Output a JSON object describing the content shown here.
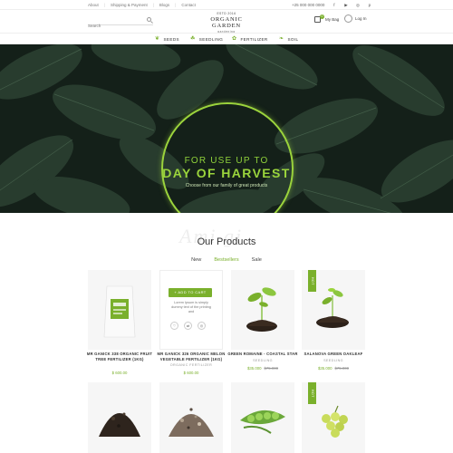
{
  "topbar": {
    "links": [
      "About",
      "Shipping & Payment",
      "Blogs",
      "Contact"
    ],
    "phone": "+25 000 000 0000",
    "social_icons": [
      "facebook-icon",
      "youtube-icon",
      "instagram-icon",
      "pinterest-icon"
    ]
  },
  "header": {
    "search_placeholder": "Search",
    "logo_est": "ESTD 2016",
    "logo_name": "ORGANIC GARDEN",
    "logo_sub": "gardening",
    "cart_count": "0",
    "cart_label": "My Bag",
    "login_label": "Log In"
  },
  "categories": [
    {
      "label": "SEEDS",
      "icon": "seed-icon"
    },
    {
      "label": "SEEDLING",
      "icon": "seedling-icon"
    },
    {
      "label": "FERTILIZER",
      "icon": "fertilizer-icon"
    },
    {
      "label": "SOIL",
      "icon": "soil-icon"
    }
  ],
  "hero": {
    "line1": "FOR USE UP TO",
    "line2": "DAY OF HARVEST",
    "subtitle": "Choose from our family of great products"
  },
  "products_section": {
    "title": "Our Products",
    "tabs": [
      "New",
      "Bestsellers",
      "Sale"
    ],
    "active_tab": "Bestsellers",
    "watermark": "Ami gi"
  },
  "hover_card": {
    "add_to_cart": "+ ADD TO CART",
    "desc": "Lorem Ipsum is simply dummy text of the printing and"
  },
  "products": [
    {
      "name": "MR GANICK 338 ORGANIC FRUIT TREE FERTILIZER (1KG)",
      "category": "",
      "price": "$ 600.00",
      "old_price": "",
      "hot": false
    },
    {
      "name": "MR GANICK 326 ORGANIC MELON VEGETABLE FERTILIZER (1KG)",
      "category": "ORGANIC FERTILIZER",
      "price": "$ 600.00",
      "old_price": "",
      "hot": false
    },
    {
      "name": "GREEN ROMAINE - COASTAL STAR",
      "category": "SEEDLING",
      "price": "$35.000",
      "old_price": "$75.000",
      "hot": false
    },
    {
      "name": "SALANOVA GREEN OAKLEAF",
      "category": "SEEDLING",
      "price": "$35.000",
      "old_price": "$75.000",
      "hot": true
    }
  ],
  "hot_label": "HOT",
  "colors": {
    "accent": "#7ab02c",
    "hero_bg": "#142019"
  }
}
